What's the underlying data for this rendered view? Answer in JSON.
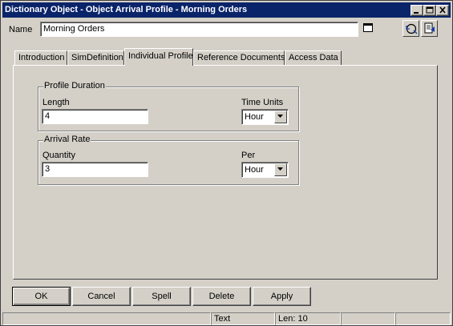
{
  "window": {
    "title": "Dictionary Object - Object Arrival Profile - Morning Orders"
  },
  "name_row": {
    "label": "Name",
    "value": "Morning Orders"
  },
  "tabs": [
    {
      "label": "Introduction"
    },
    {
      "label": "SimDefinition"
    },
    {
      "label": "Individual Profile",
      "active": true
    },
    {
      "label": "Reference Documents"
    },
    {
      "label": "Access Data"
    }
  ],
  "profile_duration": {
    "title": "Profile Duration",
    "length_label": "Length",
    "length_value": "4",
    "time_units_label": "Time Units",
    "time_units_value": "Hour"
  },
  "arrival_rate": {
    "title": "Arrival Rate",
    "quantity_label": "Quantity",
    "quantity_value": "3",
    "per_label": "Per",
    "per_value": "Hour"
  },
  "buttons": {
    "ok": "OK",
    "cancel": "Cancel",
    "spell": "Spell",
    "delete": "Delete",
    "apply": "Apply"
  },
  "status": {
    "mode": "Text",
    "length": "Len: 10"
  },
  "colors": {
    "titlebar": "#0a246a",
    "face": "#d4d0c8"
  }
}
